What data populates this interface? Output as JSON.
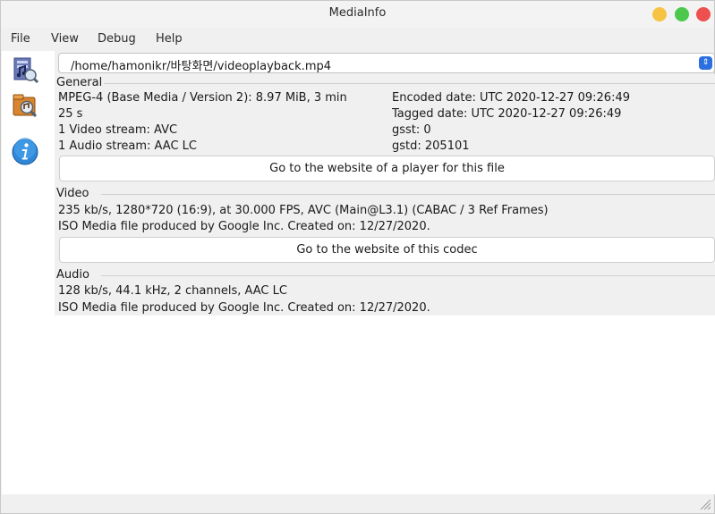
{
  "window": {
    "title": "MediaInfo"
  },
  "menu": {
    "file": "File",
    "view": "View",
    "debug": "Debug",
    "help": "Help"
  },
  "file_path": "/home/hamonikr/바탕화면/videoplayback.mp4",
  "general": {
    "label": "General",
    "line1": "MPEG-4 (Base Media / Version 2): 8.97 MiB, 3 min",
    "line2": "25 s",
    "line3": "1 Video stream: AVC",
    "line4": "1 Audio stream: AAC LC",
    "encoded_date": "Encoded date: UTC 2020-12-27 09:26:49",
    "tagged_date": "Tagged date: UTC 2020-12-27 09:26:49",
    "gsst": "gsst: 0",
    "gstd": "gstd: 205101",
    "button": "Go to the website of a player for this file"
  },
  "video": {
    "label": "Video",
    "line1": "235 kb/s, 1280*720 (16:9), at 30.000 FPS, AVC (Main@L3.1) (CABAC / 3 Ref Frames)",
    "line2": "ISO Media file produced by Google Inc. Created on: 12/27/2020.",
    "button": "Go to the website of this codec"
  },
  "audio": {
    "label": "Audio",
    "line1": "128 kb/s, 44.1 kHz, 2 channels, AAC LC",
    "line2": "ISO Media file produced by Google Inc. Created on: 12/27/2020."
  },
  "icons": {
    "sheet_view": "sheet-view-icon",
    "tree_view": "tree-view-icon",
    "info": "info-icon",
    "combo_arrow": "chevron-updown-icon"
  },
  "colors": {
    "close": "#ee4f4f",
    "maximize": "#4cc84c",
    "minimize": "#f6c344",
    "accent": "#2b6fe0"
  }
}
